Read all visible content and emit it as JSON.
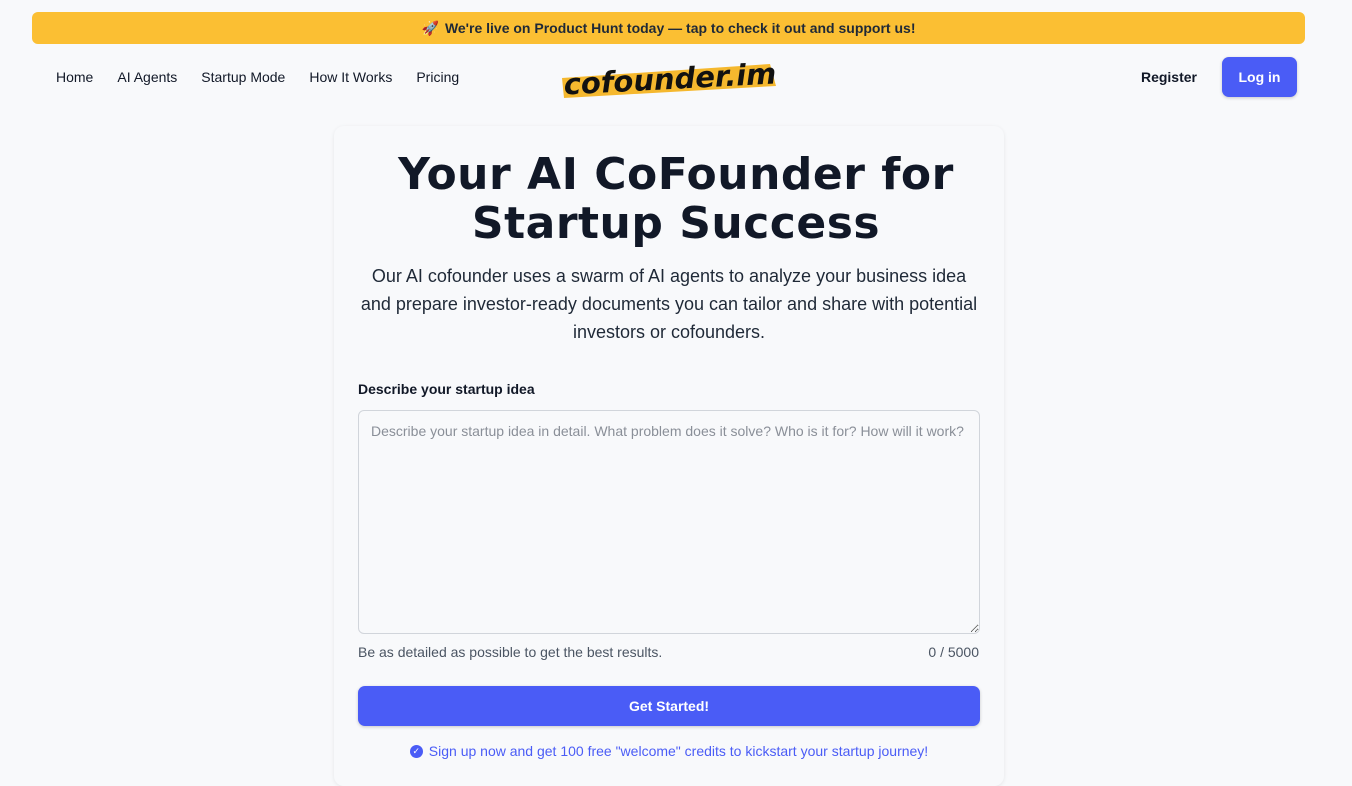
{
  "banner": {
    "icon": "rocket-icon",
    "icon_glyph": "🚀",
    "text": "We're live on Product Hunt today — tap to check it out and support us!"
  },
  "nav": {
    "items": [
      {
        "label": "Home"
      },
      {
        "label": "AI Agents"
      },
      {
        "label": "Startup Mode"
      },
      {
        "label": "How It Works"
      },
      {
        "label": "Pricing"
      }
    ],
    "logo_text": "cofounder.im",
    "register_label": "Register",
    "login_label": "Log in"
  },
  "hero": {
    "title_line1": "Your AI CoFounder for",
    "title_line2": "Startup Success",
    "subtitle": "Our AI cofounder uses a swarm of AI agents to analyze your business idea and prepare investor-ready documents you can tailor and share with potential investors or cofounders."
  },
  "form": {
    "label": "Describe your startup idea",
    "placeholder": "Describe your startup idea in detail. What problem does it solve? Who is it for? How will it work?",
    "value": "",
    "helper": "Be as detailed as possible to get the best results.",
    "counter": "0 / 5000",
    "submit_label": "Get Started!",
    "promo": "Sign up now and get 100 free \"welcome\" credits to kickstart your startup journey!"
  },
  "colors": {
    "accent": "#4a5cf6",
    "banner": "#fbbf33",
    "logo_highlight": "#f5b82e"
  }
}
